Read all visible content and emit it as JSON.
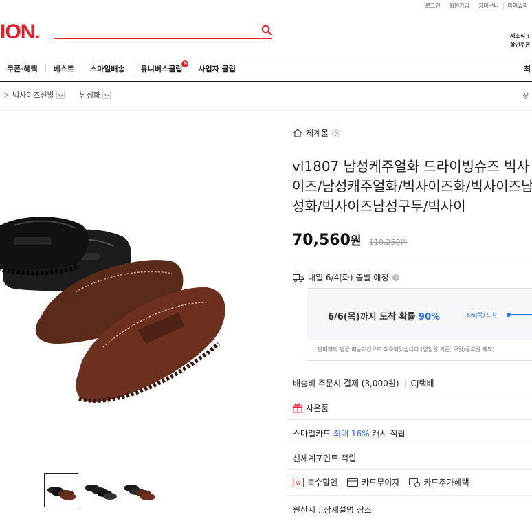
{
  "util_links": [
    "로그인",
    "회원가입",
    "장바구니",
    "마이쇼핑"
  ],
  "logo": "ION.",
  "right_info": [
    "세소식 :",
    "할인쿠폰"
  ],
  "nav": {
    "items": [
      "쿠폰·혜택",
      "베스트",
      "스마일배송",
      "유니버스클럽",
      "사업자 클럽"
    ],
    "badge": "N",
    "right": "최"
  },
  "breadcrumb": {
    "items": [
      "빅사이즈신발",
      "남성화"
    ],
    "right": "상"
  },
  "product": {
    "store": "제계몰",
    "title": "vl1807 남성케주얼화 드라이빙슈즈 빅사이즈/남성캐주얼화/빅사이즈화/빅사이즈남성화/빅사이즈남성구두/빅사이",
    "price_number": "70,560",
    "price_unit": "원",
    "original_price": "110,250원"
  },
  "shipping": {
    "dispatch": "내일 6/4(화) 출발 예정",
    "info_icon": "i",
    "probability_label": "6/6(목)까지 도착 확률",
    "probability_value": "90%",
    "arrive_label": "6/6(목) 도착",
    "note": "판매자의 평균 배송기간으로 예측되었습니다 (영업일 기준, 주말/공휴일 제외)"
  },
  "rows": {
    "fee": "배송비 주문시 결제 (3,000원)",
    "courier": "CJ택배",
    "gift": "사은품",
    "card_prefix": "스마일카드",
    "card_highlight": "최대 16%",
    "card_suffix": "캐시 적립",
    "points": "신세계포인트 적립",
    "origin": "원산지 : 상세설명 참조"
  },
  "benefits": [
    "복수할인",
    "카드무이자",
    "카드추가혜택"
  ],
  "colors": {
    "brand": "#e8202b",
    "accent": "#2f6fdc"
  }
}
